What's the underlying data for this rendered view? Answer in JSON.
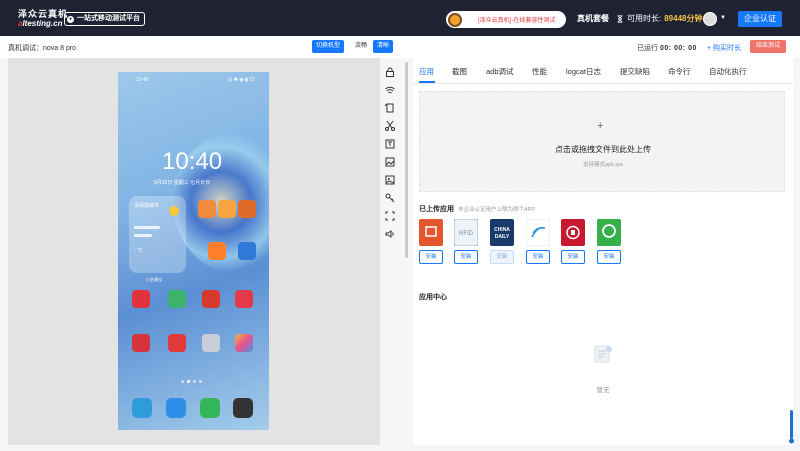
{
  "header": {
    "logo_line1": "泽众云真机",
    "logo_line2_a": "a",
    "logo_line2_b": "ltesting.cn",
    "slogan": "一站式移动测试平台",
    "notice": "[泽众云真机]-在线兼容性测试",
    "nav_plan": "真机套餐",
    "available_label": "可用时长:",
    "available_value": "89448分钟",
    "enterprise_button": "企业认证"
  },
  "subbar": {
    "device_label": "真机调试：nova 8 pro",
    "switch_button": "切换机型",
    "smooth_button": "流畅",
    "clear_button": "清晰",
    "running_label": "已运行",
    "running_time": "00: 00: 00",
    "buy_more": "+ 购买时长",
    "end_button": "结束测试"
  },
  "phone": {
    "status_time": "10:40",
    "status_right": "◎ ✱ ◉ ▮ 72",
    "clock": "10:40",
    "date": "6月25日 星期三   七月廿日",
    "weather_label": "请添加城市",
    "weather_deg": "- ℃",
    "widget_label": "小艺建议"
  },
  "tabs": [
    {
      "label": "应用",
      "active": true
    },
    {
      "label": "截图",
      "active": false
    },
    {
      "label": "adb调试",
      "active": false
    },
    {
      "label": "性能",
      "active": false
    },
    {
      "label": "logcat日志",
      "active": false
    },
    {
      "label": "提交缺陷",
      "active": false
    },
    {
      "label": "命令行",
      "active": false
    },
    {
      "label": "自动化执行",
      "active": false
    }
  ],
  "upload": {
    "plus": "+",
    "title": "点击或拖拽文件到此处上传",
    "hint": "支持格式apk,ipa"
  },
  "uploaded": {
    "title": "已上传应用",
    "hint": "非企业认证用户上限为两个APP",
    "apps": [
      {
        "icon": "box-app-icon",
        "color": "#e4572e",
        "install": "安装",
        "disabled": false
      },
      {
        "icon": "rfid-app-icon",
        "color": "#8fb3cf",
        "install": "安装",
        "disabled": false
      },
      {
        "icon": "china-daily-app-icon",
        "color": "#173a6a",
        "install": "安装",
        "disabled": true
      },
      {
        "icon": "mobile-app-icon",
        "color": "#2e9bdb",
        "install": "安装",
        "disabled": false
      },
      {
        "icon": "bank-app-icon",
        "color": "#c8192e",
        "install": "安装",
        "disabled": false
      },
      {
        "icon": "green-app-icon",
        "color": "#35b04a",
        "install": "安装",
        "disabled": false
      }
    ]
  },
  "app_center": {
    "title": "应用中心",
    "empty": "暂无"
  },
  "colors": {
    "topbar": "#1e2233",
    "accent": "#1677ff",
    "danger": "#f07369",
    "time_value": "#f6c244"
  }
}
